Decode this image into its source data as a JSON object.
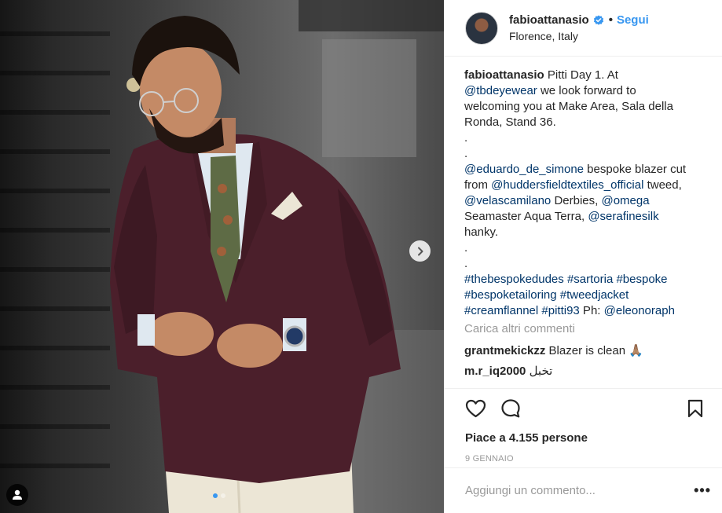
{
  "post": {
    "author": "fabioattanasio",
    "bullet": "•",
    "follow_label": "Segui",
    "location": "Florence, Italy"
  },
  "caption": {
    "user": "fabioattanasio",
    "lines": [
      " Pitti Day 1. At",
      "@tbdeyewear",
      " we look forward to",
      "welcoming you at Make Area, Sala della",
      "Ronda, Stand 36.",
      ".",
      ".",
      "@eduardo_de_simone",
      " bespoke blazer cut",
      "from ",
      "@huddersfieldtextiles_official",
      " tweed,",
      "@velascamilano",
      " Derbies, ",
      "@omega",
      "Seamaster Aqua Terra, ",
      "@serafinesilk",
      "hanky.",
      ".",
      ".",
      "#thebespokedudes #sartoria #bespoke",
      "#bespoketailoring #tweedjacket",
      "#creamflannel #pitti93",
      " Ph: ",
      "@eleonoraph"
    ]
  },
  "load_more_label": "Carica altri commenti",
  "comments": [
    {
      "user": "grantmekickzz",
      "text": " Blazer is clean 🙏🏽"
    },
    {
      "user": "m.r_iq2000",
      "text": " تخبل"
    }
  ],
  "likes": "Piace a 4.155 persone",
  "date": "9 GENNAIO",
  "add_comment_placeholder": "Aggiungi un commento...",
  "more_label": "•••",
  "icons": {
    "verified": "verified-badge-icon",
    "like": "heart-icon",
    "comment": "comment-bubble-icon",
    "save": "bookmark-icon",
    "next": "chevron-right-icon",
    "tags": "user-tag-icon"
  },
  "colors": {
    "accent": "#3897f0",
    "mention": "#003569",
    "muted": "#999999",
    "blazer": "#4b1f2b",
    "trousers": "#ece6d6"
  }
}
